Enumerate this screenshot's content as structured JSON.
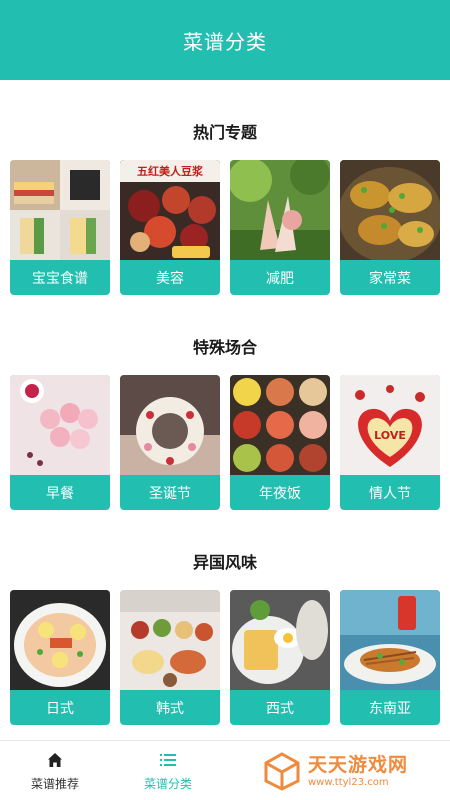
{
  "header": {
    "title": "菜谱分类"
  },
  "sections": [
    {
      "title": "热门专题",
      "items": [
        {
          "label": "宝宝食谱",
          "image": "sandwich-photo",
          "overlay": ""
        },
        {
          "label": "美容",
          "image": "red-beans-photo",
          "overlay": "五红美人豆浆"
        },
        {
          "label": "减肥",
          "image": "salad-photo",
          "overlay": ""
        },
        {
          "label": "家常菜",
          "image": "fried-dish-photo",
          "overlay": ""
        }
      ]
    },
    {
      "title": "特殊场合",
      "items": [
        {
          "label": "早餐",
          "image": "pink-buns-photo",
          "overlay": ""
        },
        {
          "label": "圣诞节",
          "image": "wreath-cookie-photo",
          "overlay": ""
        },
        {
          "label": "年夜饭",
          "image": "dish-collage-photo",
          "overlay": ""
        },
        {
          "label": "情人节",
          "image": "love-petals-photo",
          "overlay": "LOVE"
        }
      ]
    },
    {
      "title": "异国风味",
      "items": [
        {
          "label": "日式",
          "image": "noodle-bowl-photo",
          "overlay": ""
        },
        {
          "label": "韩式",
          "image": "korean-table-photo",
          "overlay": ""
        },
        {
          "label": "西式",
          "image": "western-breakfast-photo",
          "overlay": ""
        },
        {
          "label": "东南亚",
          "image": "southeast-noodles-photo",
          "overlay": ""
        }
      ]
    }
  ],
  "bottom_nav": [
    {
      "label": "菜谱推荐",
      "icon": "home-icon",
      "active": false
    },
    {
      "label": "菜谱分类",
      "icon": "list-icon",
      "active": true
    }
  ],
  "watermark": {
    "title": "天天游戏网",
    "url": "www.ttyl23.com"
  },
  "colors": {
    "accent": "#22bfb1",
    "watermark": "#f08a3c"
  }
}
